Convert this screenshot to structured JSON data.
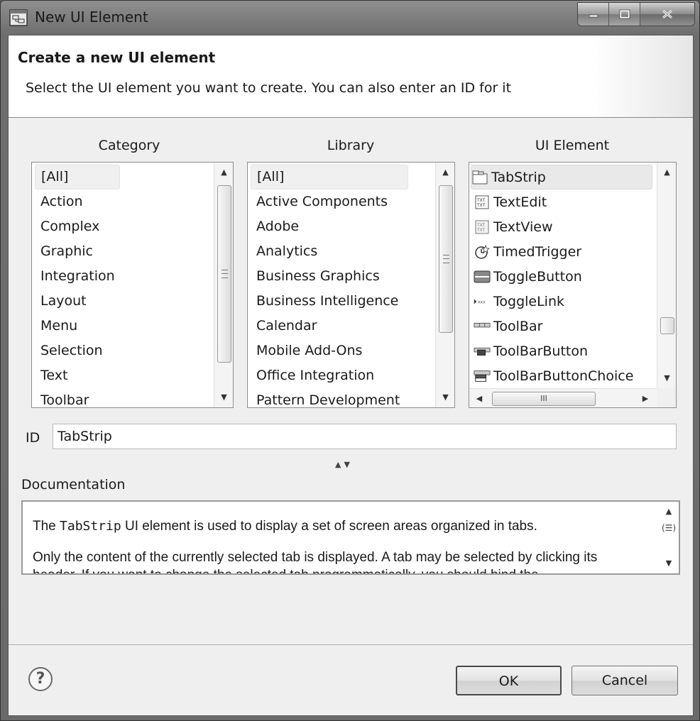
{
  "window": {
    "title": "New UI Element",
    "controls": {
      "minimize": "—",
      "maximize": "▢",
      "close": "X"
    }
  },
  "header": {
    "title": "Create a new UI element",
    "subtitle": "Select the UI element you want to create. You can also enter an ID for it"
  },
  "category": {
    "label": "Category",
    "items": [
      "[All]",
      "Action",
      "Complex",
      "Graphic",
      "Integration",
      "Layout",
      "Menu",
      "Selection",
      "Text",
      "Toolbar"
    ],
    "selected": "[All]"
  },
  "library": {
    "label": "Library",
    "items": [
      "[All]",
      "Active Components",
      "Adobe",
      "Analytics",
      "Business Graphics",
      "Business Intelligence",
      "Calendar",
      "Mobile Add-Ons",
      "Office Integration",
      "Pattern Development"
    ],
    "selected": "[All]"
  },
  "ui_element": {
    "label": "UI Element",
    "items": [
      {
        "label": "TabStrip",
        "icon": "tabstrip-icon"
      },
      {
        "label": "TextEdit",
        "icon": "textedit-icon"
      },
      {
        "label": "TextView",
        "icon": "textview-icon"
      },
      {
        "label": "TimedTrigger",
        "icon": "timedtrigger-icon"
      },
      {
        "label": "ToggleButton",
        "icon": "togglebutton-icon"
      },
      {
        "label": "ToggleLink",
        "icon": "togglelink-icon"
      },
      {
        "label": "ToolBar",
        "icon": "toolbar-icon"
      },
      {
        "label": "ToolBarButton",
        "icon": "toolbarbutton-icon"
      },
      {
        "label": "ToolBarButtonChoice",
        "icon": "toolbarbuttonchoice-icon"
      }
    ],
    "selected": "TabStrip",
    "hscroll_grip": "III"
  },
  "id_field": {
    "label": "ID",
    "value": "TabStrip"
  },
  "documentation": {
    "label": "Documentation",
    "p1_prefix": "The ",
    "p1_code": "TabStrip",
    "p1_suffix": " UI element is used to display a set of screen areas organized in tabs.",
    "p2": "Only the content of the currently selected tab is displayed. A tab may be selected by clicking its",
    "p3": "header. If you want to change the selected tab programmatically, you should bind the"
  },
  "footer": {
    "help": "?",
    "ok": "OK",
    "cancel": "Cancel"
  }
}
